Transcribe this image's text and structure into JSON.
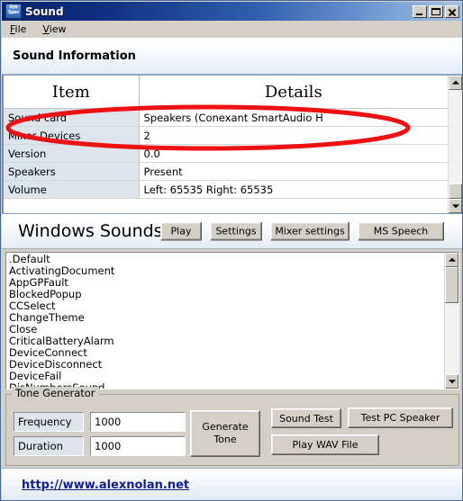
{
  "window": {
    "title": "Sound",
    "icon": "sys-spec-icon",
    "icon_text_line1": "Sys",
    "icon_text_line2": "Spec",
    "controls": {
      "minimize": "Minimize",
      "maximize": "Maximize",
      "close": "Close"
    }
  },
  "menubar": {
    "items": [
      {
        "label": "File",
        "accel": "F"
      },
      {
        "label": "View",
        "accel": "V"
      }
    ]
  },
  "info_panel": {
    "title": "Sound Information",
    "table": {
      "columns": [
        "Item",
        "Details"
      ],
      "rows": [
        {
          "item": "Sound card",
          "detail": "Speakers (Conexant SmartAudio H"
        },
        {
          "item": "Mixer Devices",
          "detail": "2"
        },
        {
          "item": "Version",
          "detail": "0.0"
        },
        {
          "item": "Speakers",
          "detail": "Present"
        },
        {
          "item": "Volume",
          "detail": "Left: 65535 Right: 65535"
        }
      ],
      "scrollbar": {
        "up_arrow": "scroll-up-icon",
        "down_arrow": "scroll-down-icon",
        "thumb_position": "bottom"
      }
    }
  },
  "sounds_panel": {
    "title": "Windows Sounds",
    "buttons": [
      {
        "label": "Play",
        "name": "play-button"
      },
      {
        "label": "Settings",
        "name": "settings-button"
      },
      {
        "label": "Mixer settings",
        "name": "mixer-settings-button"
      },
      {
        "label": "MS Speech",
        "name": "ms-speech-button"
      }
    ],
    "list": {
      "items": [
        ".Default",
        "ActivatingDocument",
        "AppGPFault",
        "BlockedPopup",
        "CCSelect",
        "ChangeTheme",
        "Close",
        "CriticalBatteryAlarm",
        "DeviceConnect",
        "DeviceDisconnect",
        "DeviceFail",
        "DisNumbersSound"
      ],
      "scrollbar": {
        "up_arrow": "scroll-up-icon",
        "down_arrow": "scroll-down-icon",
        "thumb_position": "top"
      }
    }
  },
  "tone_generator": {
    "legend": "Tone Generator",
    "fields": [
      {
        "label": "Frequency",
        "value": "1000"
      },
      {
        "label": "Duration",
        "value": "1000"
      }
    ],
    "generate_button": {
      "line1": "Generate",
      "line2": "Tone"
    },
    "buttons": [
      {
        "label": "Sound Test",
        "name": "sound-test-button"
      },
      {
        "label": "Test PC Speaker",
        "name": "test-pc-speaker-button"
      },
      {
        "label": "Play WAV File",
        "name": "play-wav-file-button"
      }
    ]
  },
  "footer": {
    "link_text": "http://www.alexnolan.net"
  },
  "annotation": {
    "shape": "ellipse",
    "color": "#ee1111",
    "stroke_width": 5,
    "target_rows": [
      "Sound card",
      "Mixer Devices"
    ]
  },
  "colors": {
    "titlebar_start": "#0a246a",
    "titlebar_end": "#a8c4e4",
    "face": "#d4d0c8",
    "item_cell": "#dde4ec",
    "link": "#141f8c",
    "annotation": "#ee1111"
  }
}
